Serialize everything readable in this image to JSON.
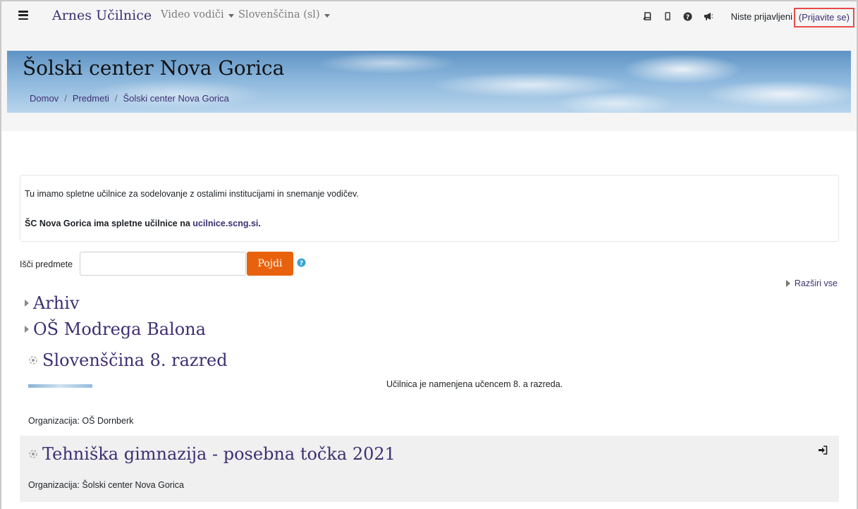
{
  "navbar": {
    "brand": "Arnes Učilnice",
    "menus": [
      "Video vodiči",
      "Slovenščina (sl)"
    ],
    "user_status": "Niste prijavljeni",
    "login_link": "(Prijavite se)",
    "icons": [
      "book-icon",
      "mobile-icon",
      "question-circle-icon",
      "bullhorn-icon"
    ]
  },
  "header": {
    "title": "Šolski center Nova Gorica",
    "breadcrumb": [
      "Domov",
      "Predmeti",
      "Šolski center Nova Gorica"
    ]
  },
  "info": {
    "line1": "Tu imamo spletne učilnice za sodelovanje z ostalimi institucijami in snemanje vodičev.",
    "line2_prefix": "ŠC Nova Gorica ima spletne učilnice na ",
    "line2_link": "ucilnice.scng.si",
    "line2_suffix": "."
  },
  "search": {
    "label": "Išči predmete",
    "value": "",
    "button": "Pojdi"
  },
  "expand_all": "Razširi vse",
  "categories": [
    "Arhiv",
    "OŠ Modrega Balona"
  ],
  "courses": [
    {
      "title": "Slovenščina 8. razred",
      "summary": "Učilnica je namenjena učencem 8. a razreda.",
      "organization": "Organizacija: OŠ Dornberk"
    },
    {
      "title": "Tehniška gimnazija - posebna točka 2021",
      "summary": "",
      "organization": "Organizacija: Šolski center Nova Gorica"
    }
  ],
  "colors": {
    "brand": "#3e2f73",
    "button": "#e8620d",
    "highlight_border": "#e74c4c"
  }
}
